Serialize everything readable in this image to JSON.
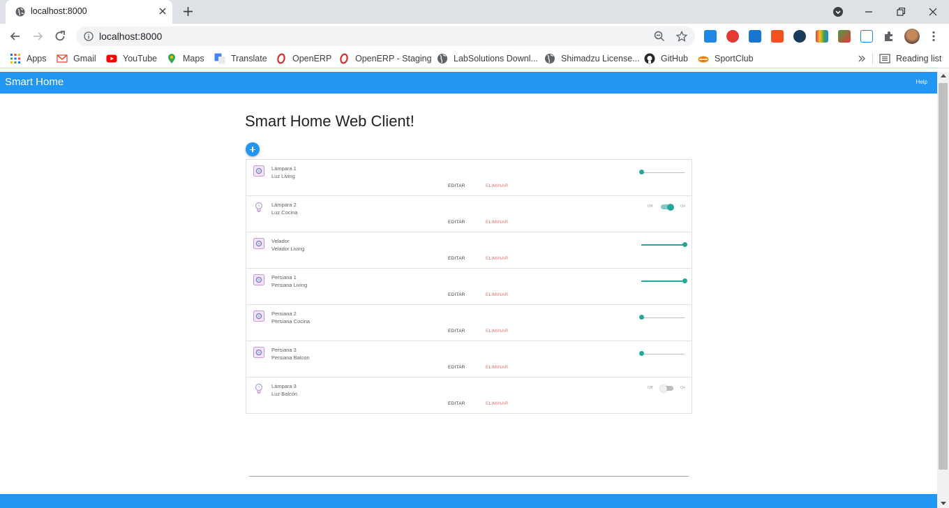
{
  "browser": {
    "tab_title": "localhost:8000",
    "url": "localhost:8000",
    "bookmarks": [
      {
        "label": "Apps",
        "icon": "apps-grid-icon"
      },
      {
        "label": "Gmail",
        "icon": "gmail-icon"
      },
      {
        "label": "YouTube",
        "icon": "youtube-icon"
      },
      {
        "label": "Maps",
        "icon": "maps-icon"
      },
      {
        "label": "Translate",
        "icon": "translate-icon"
      },
      {
        "label": "OpenERP",
        "icon": "openerp-icon"
      },
      {
        "label": "OpenERP - Staging",
        "icon": "openerp-icon"
      },
      {
        "label": "LabSolutions Downl...",
        "icon": "globe-icon"
      },
      {
        "label": "Shimadzu License...",
        "icon": "globe-icon"
      },
      {
        "label": "GitHub",
        "icon": "github-icon"
      },
      {
        "label": "SportClub",
        "icon": "sportclub-icon"
      }
    ],
    "reading_list": "Reading list"
  },
  "app": {
    "title": "Smart Home",
    "help": "Help",
    "heading": "Smart Home Web Client!",
    "edit_label": "EDITAR",
    "delete_label": "ELIMINAR",
    "switch_off": "Off",
    "switch_on": "On"
  },
  "devices": [
    {
      "name": "Lámpara 1",
      "description": "Luz Living",
      "icon": "device-box-icon",
      "control": "slider",
      "value": 0.0
    },
    {
      "name": "Lámpara 2",
      "description": "Luz Cocina",
      "icon": "lightbulb-icon",
      "control": "switch",
      "on": true
    },
    {
      "name": "Velador",
      "description": "Velador Living",
      "icon": "device-box-icon",
      "control": "slider",
      "value": 1.0
    },
    {
      "name": "Persiana 1",
      "description": "Persiana Living",
      "icon": "device-box-icon",
      "control": "slider",
      "value": 1.0
    },
    {
      "name": "Persiana 2",
      "description": "Persiana Cocina",
      "icon": "device-box-icon",
      "control": "slider",
      "value": 0.0
    },
    {
      "name": "Persiana 3",
      "description": "Persiana Balcon",
      "icon": "device-box-icon",
      "control": "slider",
      "value": 0.0
    },
    {
      "name": "Lámpara 3",
      "description": "Luz Balcón",
      "icon": "lightbulb-icon",
      "control": "switch",
      "on": false
    }
  ],
  "colors": {
    "primary": "#2196f3",
    "accent": "#26a69a",
    "delete": "#e57373"
  }
}
